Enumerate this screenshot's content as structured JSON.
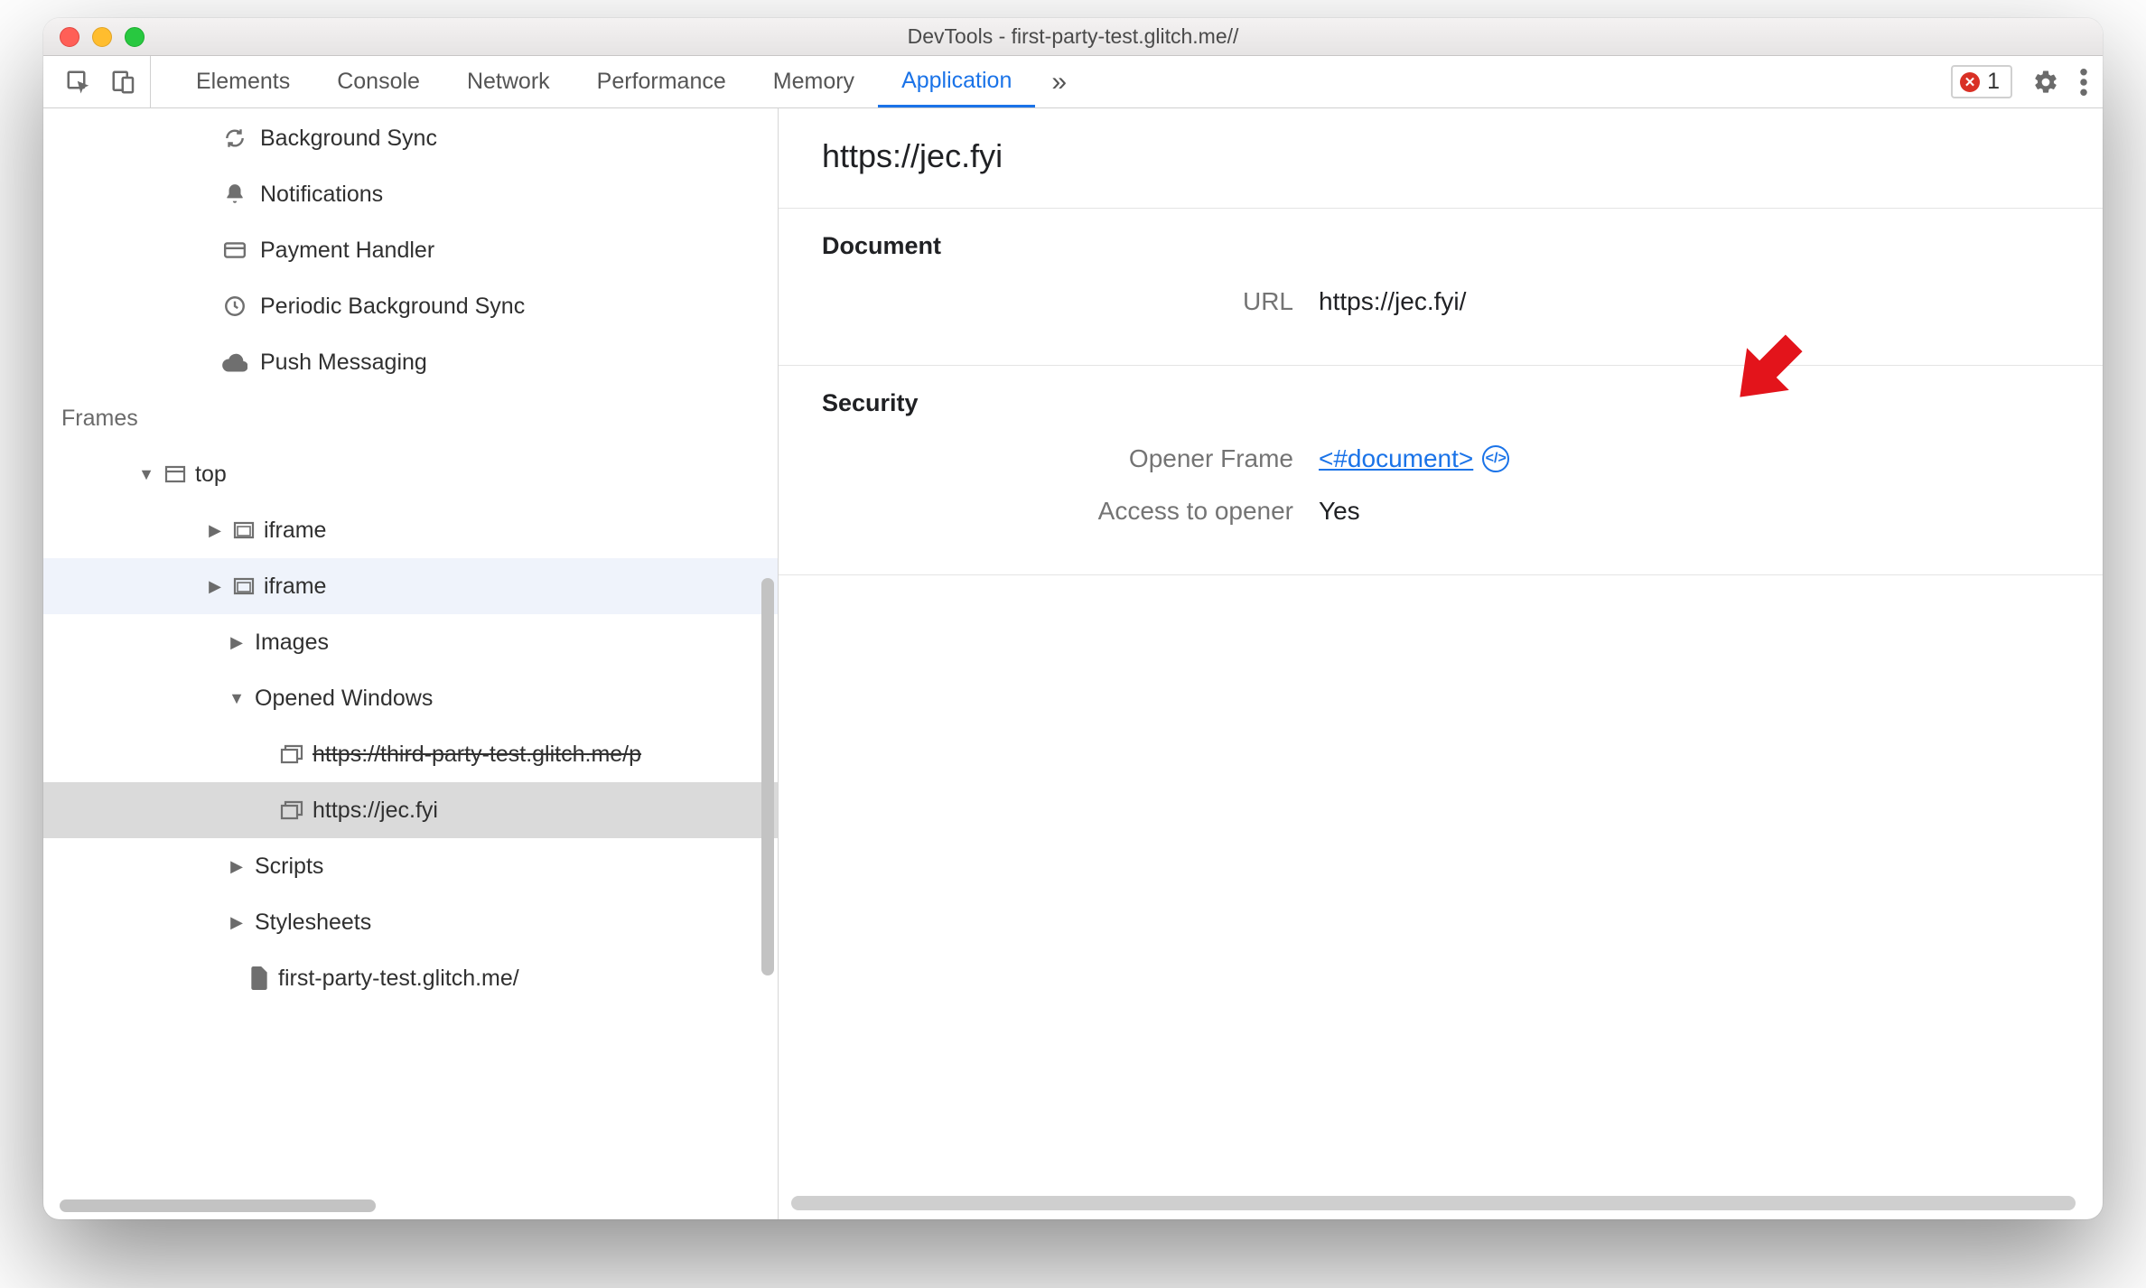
{
  "window": {
    "title": "DevTools - first-party-test.glitch.me//"
  },
  "toolbar": {
    "tabs": [
      "Elements",
      "Console",
      "Network",
      "Performance",
      "Memory",
      "Application"
    ],
    "active_tab_index": 5,
    "error_count": "1"
  },
  "sidebar": {
    "service_items": [
      {
        "icon": "sync-icon",
        "label": "Background Sync"
      },
      {
        "icon": "bell-icon",
        "label": "Notifications"
      },
      {
        "icon": "card-icon",
        "label": "Payment Handler"
      },
      {
        "icon": "clock-icon",
        "label": "Periodic Background Sync"
      },
      {
        "icon": "cloud-icon",
        "label": "Push Messaging"
      }
    ],
    "frames_heading": "Frames",
    "tree": {
      "top_label": "top",
      "iframe_label_1": "iframe",
      "iframe_label_2": "iframe",
      "images_label": "Images",
      "opened_windows_label": "Opened Windows",
      "opened_window_1": "https://third-party-test.glitch.me/p",
      "opened_window_2": "https://jec.fyi",
      "scripts_label": "Scripts",
      "stylesheets_label": "Stylesheets",
      "doc_label": "first-party-test.glitch.me/"
    }
  },
  "main": {
    "title_url": "https://jec.fyi",
    "document": {
      "heading": "Document",
      "url_key": "URL",
      "url_value": "https://jec.fyi/"
    },
    "security": {
      "heading": "Security",
      "opener_frame_key": "Opener Frame",
      "opener_frame_value": "<#document>",
      "access_key": "Access to opener",
      "access_value": "Yes"
    }
  }
}
